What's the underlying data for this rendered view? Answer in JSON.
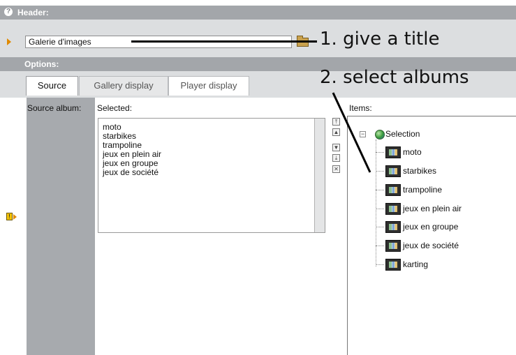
{
  "header": {
    "label": "Header:"
  },
  "title_field": {
    "value": "Galerie d'images"
  },
  "annotations": {
    "step1": "1. give a title",
    "step2": "2. select albums"
  },
  "options": {
    "label": "Options:"
  },
  "tabs": [
    {
      "label": "Source",
      "active": true
    },
    {
      "label": "Gallery display",
      "active": false
    },
    {
      "label": "Player display",
      "active": false
    }
  ],
  "source_album_label": "Source album:",
  "selected": {
    "label": "Selected:",
    "items": [
      "moto",
      "starbikes",
      "trampoline",
      "jeux en plein air",
      "jeux en groupe",
      "jeux de société"
    ]
  },
  "items": {
    "label": "Items:",
    "root": "Selection",
    "albums": [
      "moto",
      "starbikes",
      "trampoline",
      "jeux en plein air",
      "jeux en groupe",
      "jeux de société",
      "karting"
    ]
  },
  "controls": [
    "move-top-icon",
    "move-up-icon",
    "move-down-icon",
    "move-bottom-icon",
    "remove-icon"
  ],
  "colors": {
    "section_header": "#a3a6aa",
    "accent_arrow": "#e08a00",
    "left_panel": "#a7aaae"
  }
}
